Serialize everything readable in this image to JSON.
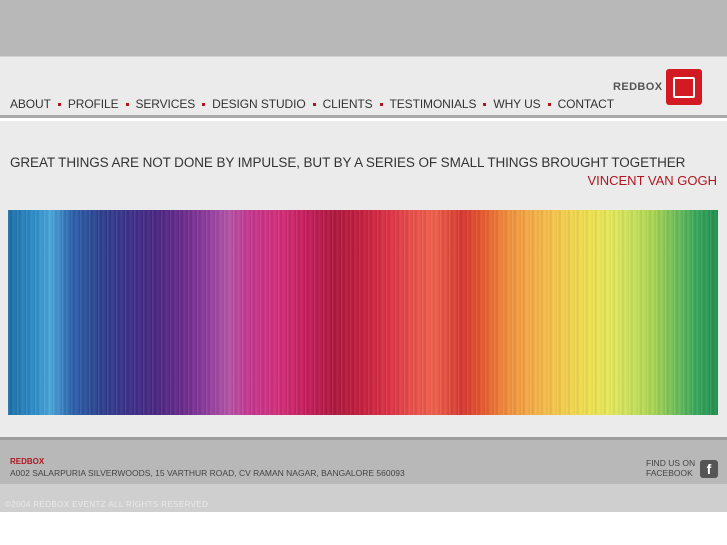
{
  "nav": {
    "items": [
      "ABOUT",
      "PROFILE",
      "SERVICES",
      "DESIGN STUDIO",
      "CLIENTS",
      "TESTIMONIALS",
      "WHY US",
      "CONTACT"
    ]
  },
  "logo": {
    "text": "REDBOX"
  },
  "quote": {
    "text": "GREAT THINGS ARE NOT DONE BY IMPULSE, BUT BY A SERIES OF SMALL THINGS BROUGHT TOGETHER",
    "author": "VINCENT VAN GOGH"
  },
  "footer": {
    "brand": "REDBOX",
    "address": "A002 SALARPURIA SILVERWOODS, 15 VARTHUR ROAD, CV RAMAN NAGAR, BANGALORE 560093",
    "find_us_line1": "FIND US ON",
    "find_us_line2": "FACEBOOK",
    "facebook_glyph": "f",
    "copyright": "©2004 REDBOX EVENTZ ALL RIGHTS RESERVED"
  },
  "colors": {
    "accent": "#b01622",
    "logo_red": "#d31a23"
  }
}
